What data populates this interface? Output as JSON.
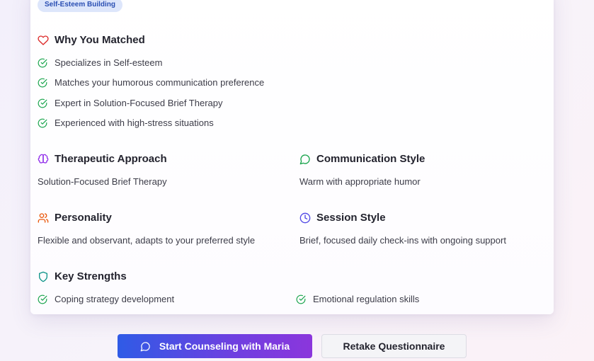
{
  "badge": "Self-Esteem Building",
  "why_matched": {
    "title": "Why You Matched",
    "items": [
      "Specializes in Self-esteem",
      "Matches your humorous communication preference",
      "Expert in Solution-Focused Brief Therapy",
      "Experienced with high-stress situations"
    ]
  },
  "therapeutic_approach": {
    "title": "Therapeutic Approach",
    "text": "Solution-Focused Brief Therapy"
  },
  "communication_style": {
    "title": "Communication Style",
    "text": "Warm with appropriate humor"
  },
  "personality": {
    "title": "Personality",
    "text": "Flexible and observant, adapts to your preferred style"
  },
  "session_style": {
    "title": "Session Style",
    "text": "Brief, focused daily check-ins with ongoing support"
  },
  "key_strengths": {
    "title": "Key Strengths",
    "items": [
      "Coping strategy development",
      "Emotional regulation skills"
    ]
  },
  "actions": {
    "start_label": "Start Counseling with Maria",
    "retake_label": "Retake Questionnaire"
  },
  "icons": {
    "why_matched": "heart-icon",
    "therapeutic_approach": "brain-icon",
    "communication_style": "message-circle-icon",
    "personality": "users-icon",
    "session_style": "clock-icon",
    "key_strengths": "shield-icon",
    "check": "check-circle-icon"
  },
  "colors": {
    "heart": "#dc2626",
    "brain": "#9333ea",
    "message": "#16a34a",
    "users": "#ea580c",
    "clock": "#4f46e5",
    "shield": "#0d9488",
    "check": "#16a34a",
    "primary_gradient_start": "#2f5be6",
    "primary_gradient_end": "#8b36dc"
  }
}
